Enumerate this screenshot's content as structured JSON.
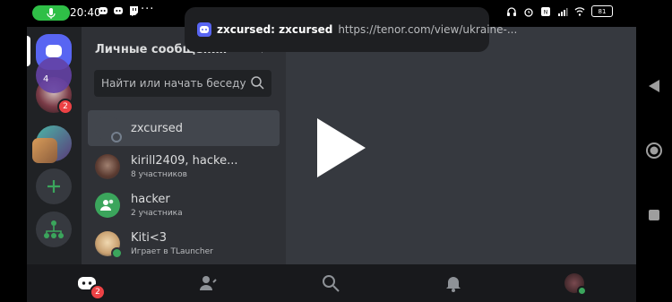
{
  "status_bar": {
    "time": "20:40",
    "dots": "···",
    "battery": "81"
  },
  "notification": {
    "title": "zxcursed: zxcursed",
    "url": "https://tenor.com/view/ukraine-..."
  },
  "guilds": {
    "home_badge": "",
    "user_badge": "2",
    "group_count": "4"
  },
  "dm_panel": {
    "title": "Личные сообщения",
    "search_placeholder": "Найти или начать беседу",
    "items": [
      {
        "name": "zxcursed",
        "sub": ""
      },
      {
        "name": "kirill2409, hacke...",
        "sub": "8 участников"
      },
      {
        "name": "hacker",
        "sub": "2 участника"
      },
      {
        "name": "Kiti<3",
        "sub": "Играет в TLauncher"
      }
    ]
  },
  "bottom_nav": {
    "home_badge": "2"
  },
  "colors": {
    "accent": "#5865f2",
    "green": "#3ba55c",
    "red": "#ed4245"
  }
}
